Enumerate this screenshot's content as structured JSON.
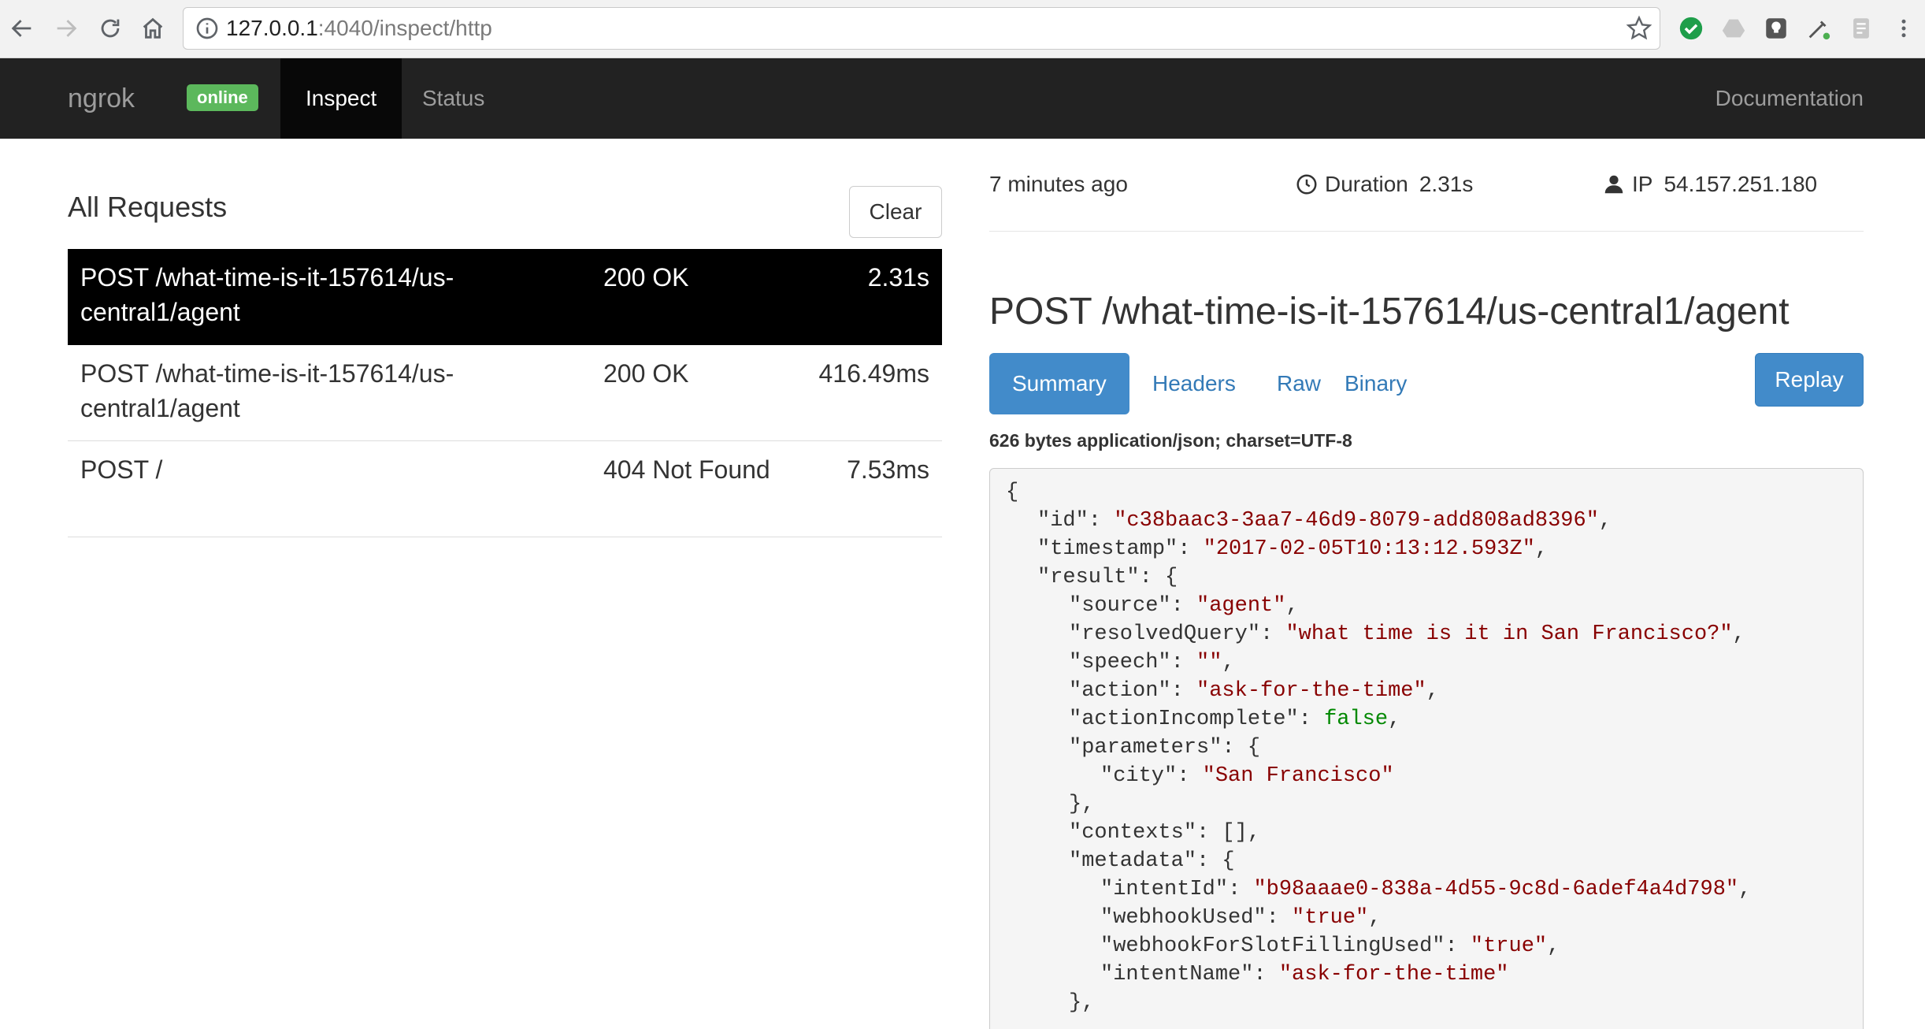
{
  "browser": {
    "url_host": "127.0.0.1",
    "url_rest": ":4040/inspect/http"
  },
  "navbar": {
    "brand": "ngrok",
    "status_badge": "online",
    "tabs": [
      {
        "label": "Inspect",
        "active": true
      },
      {
        "label": "Status",
        "active": false
      }
    ],
    "docs_link": "Documentation"
  },
  "requests_panel": {
    "title": "All Requests",
    "clear_label": "Clear",
    "rows": [
      {
        "path": "POST /what-time-is-it-157614/us-central1/agent",
        "status": "200 OK",
        "duration": "2.31s",
        "selected": true
      },
      {
        "path": "POST /what-time-is-it-157614/us-central1/agent",
        "status": "200 OK",
        "duration": "416.49ms",
        "selected": false
      },
      {
        "path": "POST /",
        "status": "404 Not Found",
        "duration": "7.53ms",
        "selected": false
      }
    ]
  },
  "detail": {
    "time_ago": "7 minutes ago",
    "duration_label": "Duration",
    "duration_value": "2.31s",
    "ip_label": "IP",
    "ip_value": "54.157.251.180",
    "title": "POST /what-time-is-it-157614/us-central1/agent",
    "tabs": [
      {
        "label": "Summary",
        "active": true
      },
      {
        "label": "Headers",
        "active": false
      },
      {
        "label": "Raw",
        "active": false
      },
      {
        "label": "Binary",
        "active": false
      }
    ],
    "replay_label": "Replay",
    "content_type": "626 bytes application/json; charset=UTF-8",
    "body_lines": [
      {
        "indent": 0,
        "parts": [
          {
            "t": "{",
            "c": "p"
          }
        ]
      },
      {
        "indent": 1,
        "parts": [
          {
            "t": "\"id\": ",
            "c": "p"
          },
          {
            "t": "\"c38baac3-3aa7-46d9-8079-add808ad8396\"",
            "c": "s"
          },
          {
            "t": ",",
            "c": "p"
          }
        ]
      },
      {
        "indent": 1,
        "parts": [
          {
            "t": "\"timestamp\": ",
            "c": "p"
          },
          {
            "t": "\"2017-02-05T10:13:12.593Z\"",
            "c": "s"
          },
          {
            "t": ",",
            "c": "p"
          }
        ]
      },
      {
        "indent": 1,
        "parts": [
          {
            "t": "\"result\": {",
            "c": "p"
          }
        ]
      },
      {
        "indent": 2,
        "parts": [
          {
            "t": "\"source\": ",
            "c": "p"
          },
          {
            "t": "\"agent\"",
            "c": "s"
          },
          {
            "t": ",",
            "c": "p"
          }
        ]
      },
      {
        "indent": 2,
        "parts": [
          {
            "t": "\"resolvedQuery\": ",
            "c": "p"
          },
          {
            "t": "\"what time is it in San Francisco?\"",
            "c": "s"
          },
          {
            "t": ",",
            "c": "p"
          }
        ]
      },
      {
        "indent": 2,
        "parts": [
          {
            "t": "\"speech\": ",
            "c": "p"
          },
          {
            "t": "\"\"",
            "c": "s"
          },
          {
            "t": ",",
            "c": "p"
          }
        ]
      },
      {
        "indent": 2,
        "parts": [
          {
            "t": "\"action\": ",
            "c": "p"
          },
          {
            "t": "\"ask-for-the-time\"",
            "c": "s"
          },
          {
            "t": ",",
            "c": "p"
          }
        ]
      },
      {
        "indent": 2,
        "parts": [
          {
            "t": "\"actionIncomplete\": ",
            "c": "p"
          },
          {
            "t": "false",
            "c": "k"
          },
          {
            "t": ",",
            "c": "p"
          }
        ]
      },
      {
        "indent": 2,
        "parts": [
          {
            "t": "\"parameters\": {",
            "c": "p"
          }
        ]
      },
      {
        "indent": 3,
        "parts": [
          {
            "t": "\"city\": ",
            "c": "p"
          },
          {
            "t": "\"San Francisco\"",
            "c": "s"
          }
        ]
      },
      {
        "indent": 2,
        "parts": [
          {
            "t": "},",
            "c": "p"
          }
        ]
      },
      {
        "indent": 2,
        "parts": [
          {
            "t": "\"contexts\": [],",
            "c": "p"
          }
        ]
      },
      {
        "indent": 2,
        "parts": [
          {
            "t": "\"metadata\": {",
            "c": "p"
          }
        ]
      },
      {
        "indent": 3,
        "parts": [
          {
            "t": "\"intentId\": ",
            "c": "p"
          },
          {
            "t": "\"b98aaae0-838a-4d55-9c8d-6adef4a4d798\"",
            "c": "s"
          },
          {
            "t": ",",
            "c": "p"
          }
        ]
      },
      {
        "indent": 3,
        "parts": [
          {
            "t": "\"webhookUsed\": ",
            "c": "p"
          },
          {
            "t": "\"true\"",
            "c": "s"
          },
          {
            "t": ",",
            "c": "p"
          }
        ]
      },
      {
        "indent": 3,
        "parts": [
          {
            "t": "\"webhookForSlotFillingUsed\": ",
            "c": "p"
          },
          {
            "t": "\"true\"",
            "c": "s"
          },
          {
            "t": ",",
            "c": "p"
          }
        ]
      },
      {
        "indent": 3,
        "parts": [
          {
            "t": "\"intentName\": ",
            "c": "p"
          },
          {
            "t": "\"ask-for-the-time\"",
            "c": "s"
          }
        ]
      },
      {
        "indent": 2,
        "parts": [
          {
            "t": "},",
            "c": "p"
          }
        ]
      }
    ]
  },
  "colors": {
    "navbar_bg": "#222222",
    "online_badge": "#5cb85c",
    "primary": "#428bca",
    "link": "#337ab7",
    "json_string": "#880000",
    "json_keyword": "#008800"
  }
}
